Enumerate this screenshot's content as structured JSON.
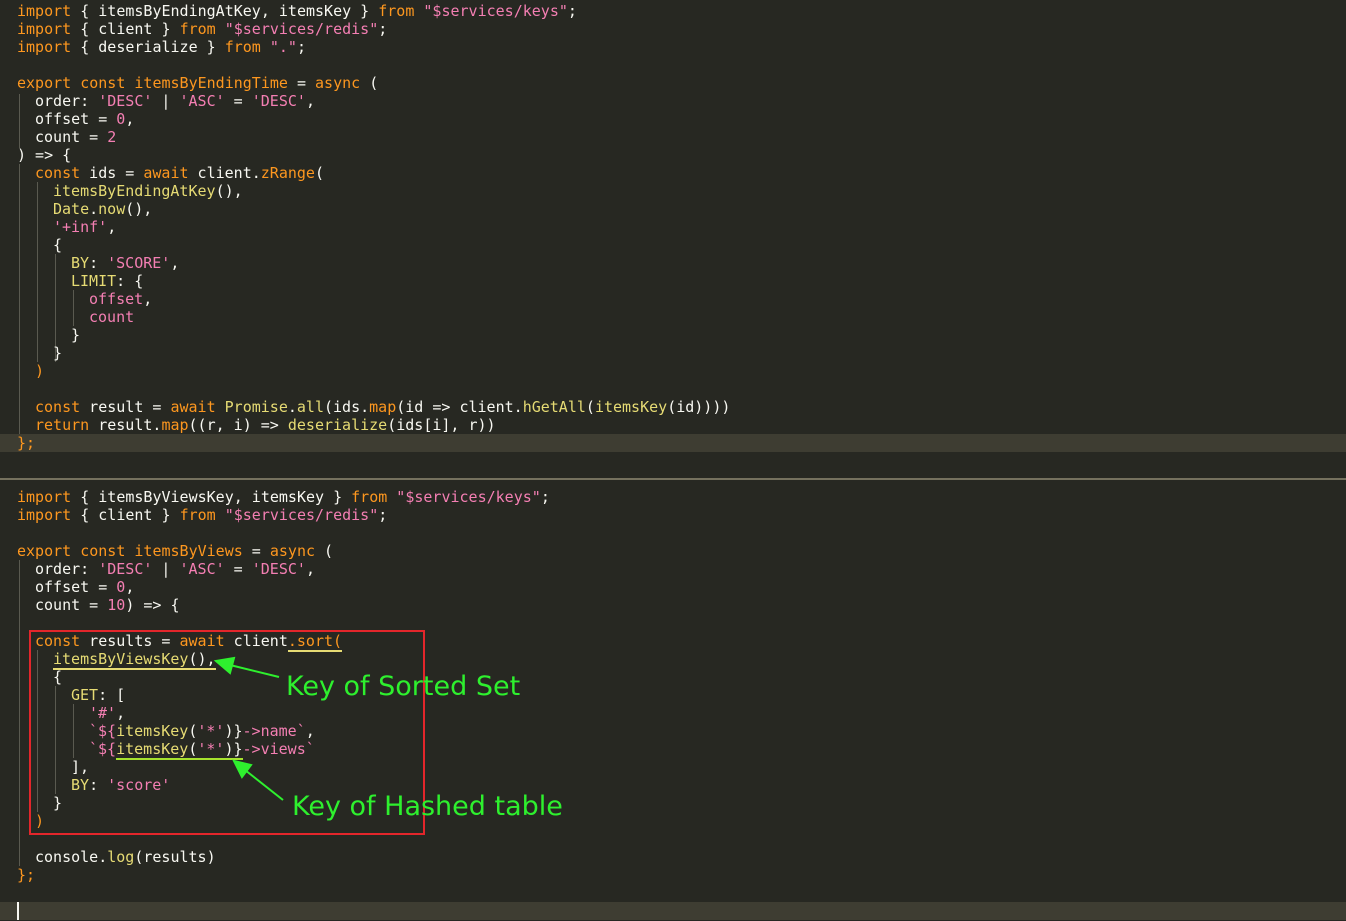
{
  "editor": {
    "top_pane": {
      "l1": {
        "a": "import",
        "b": " { itemsByEndingAtKey, itemsKey } ",
        "c": "from",
        "d": " \"$services/keys\"",
        "e": ";"
      },
      "l2": {
        "a": "import",
        "b": " { client } ",
        "c": "from",
        "d": " \"$services/redis\"",
        "e": ";"
      },
      "l3": {
        "a": "import",
        "b": " { deserialize } ",
        "c": "from",
        "d": " \".\"",
        "e": ";"
      },
      "l5": {
        "a": "export",
        "b": "const",
        "c": "itemsByEndingTime",
        "d": " = ",
        "e": "async",
        "f": " ("
      },
      "l6": {
        "a": "order: ",
        "b": "'DESC'",
        "c": " | ",
        "d": "'ASC'",
        "e": " = ",
        "f": "'DESC'",
        "g": ","
      },
      "l7": {
        "a": "offset = ",
        "b": "0",
        "c": ","
      },
      "l8": {
        "a": "count = ",
        "b": "2"
      },
      "l9": {
        "a": ") => {"
      },
      "l10": {
        "a": "const",
        "b": " ids = ",
        "c": "await",
        "d": " client.",
        "e": "zRange",
        "f": "("
      },
      "l11": {
        "a": "itemsByEndingAtKey",
        "b": "(),"
      },
      "l12": {
        "a": "Date",
        "b": ".",
        "c": "now",
        "d": "(),"
      },
      "l13": {
        "a": "'+inf'",
        "b": ","
      },
      "l14": {
        "a": "{"
      },
      "l15": {
        "a": "BY",
        "b": ": ",
        "c": "'SCORE'",
        "d": ","
      },
      "l16": {
        "a": "LIMIT",
        "b": ": {"
      },
      "l17": {
        "a": "offset",
        "b": ","
      },
      "l18": {
        "a": "count"
      },
      "l19": {
        "a": "}"
      },
      "l20": {
        "a": "}"
      },
      "l21": {
        "a": ")"
      },
      "l23": {
        "a": "const",
        "b": " result = ",
        "c": "await",
        "d": " ",
        "e": "Promise",
        "f": ".",
        "g": "all",
        "h": "(ids.",
        "i": "map",
        "j": "(id => client.",
        "k": "hGetAll",
        "l": "(",
        "m": "itemsKey",
        "n": "(id))))"
      },
      "l24": {
        "a": "return",
        "b": " result.",
        "c": "map",
        "d": "((r, i) => ",
        "e": "deserialize",
        "f": "(ids[i], r))"
      },
      "l25": {
        "a": "};"
      }
    },
    "bottom_pane": {
      "l1": {
        "a": "import",
        "b": " { itemsByViewsKey, itemsKey } ",
        "c": "from",
        "d": " \"$services/keys\"",
        "e": ";"
      },
      "l2": {
        "a": "import",
        "b": " { client } ",
        "c": "from",
        "d": " \"$services/redis\"",
        "e": ";"
      },
      "l4": {
        "a": "export",
        "b": "const",
        "c": "itemsByViews",
        "d": " = ",
        "e": "async",
        "f": " ("
      },
      "l5": {
        "a": "order: ",
        "b": "'DESC'",
        "c": " | ",
        "d": "'ASC'",
        "e": " = ",
        "f": "'DESC'",
        "g": ","
      },
      "l6": {
        "a": "offset = ",
        "b": "0",
        "c": ","
      },
      "l7": {
        "a": "count = ",
        "b": "10",
        "c": ") => {"
      },
      "l9": {
        "a": "const",
        "b": " results = ",
        "c": "await",
        "d": " client",
        "e": ".sort(",
        "f": ""
      },
      "l10": {
        "a": "itemsByViewsKey",
        "b": "(),"
      },
      "l11": {
        "a": "{"
      },
      "l12": {
        "a": "GET",
        "b": ": ["
      },
      "l13": {
        "a": "'#'",
        "b": ","
      },
      "l14": {
        "a": "`${",
        "b": "itemsKey",
        "c": "(",
        "d": "'*'",
        "e": ")}",
        "f": "->name`",
        "g": ","
      },
      "l15": {
        "a": "`${",
        "b": "itemsKey",
        "c": "(",
        "d": "'*'",
        "e": ")}",
        "f": "->views`"
      },
      "l16": {
        "a": "],"
      },
      "l17": {
        "a": "BY",
        "b": ": ",
        "c": "'score'"
      },
      "l18": {
        "a": "}"
      },
      "l19": {
        "a": ")"
      },
      "l21": {
        "a": "console",
        "b": ".",
        "c": "log",
        "d": "(results)"
      },
      "l22": {
        "a": "};"
      }
    }
  },
  "annotations": {
    "sorted_set": "Key of Sorted Set",
    "hashed_table": "Key of Hashed table"
  },
  "colors": {
    "background": "#272822",
    "annotation": "#2ef02e",
    "highlight_box": "#e3262b"
  }
}
